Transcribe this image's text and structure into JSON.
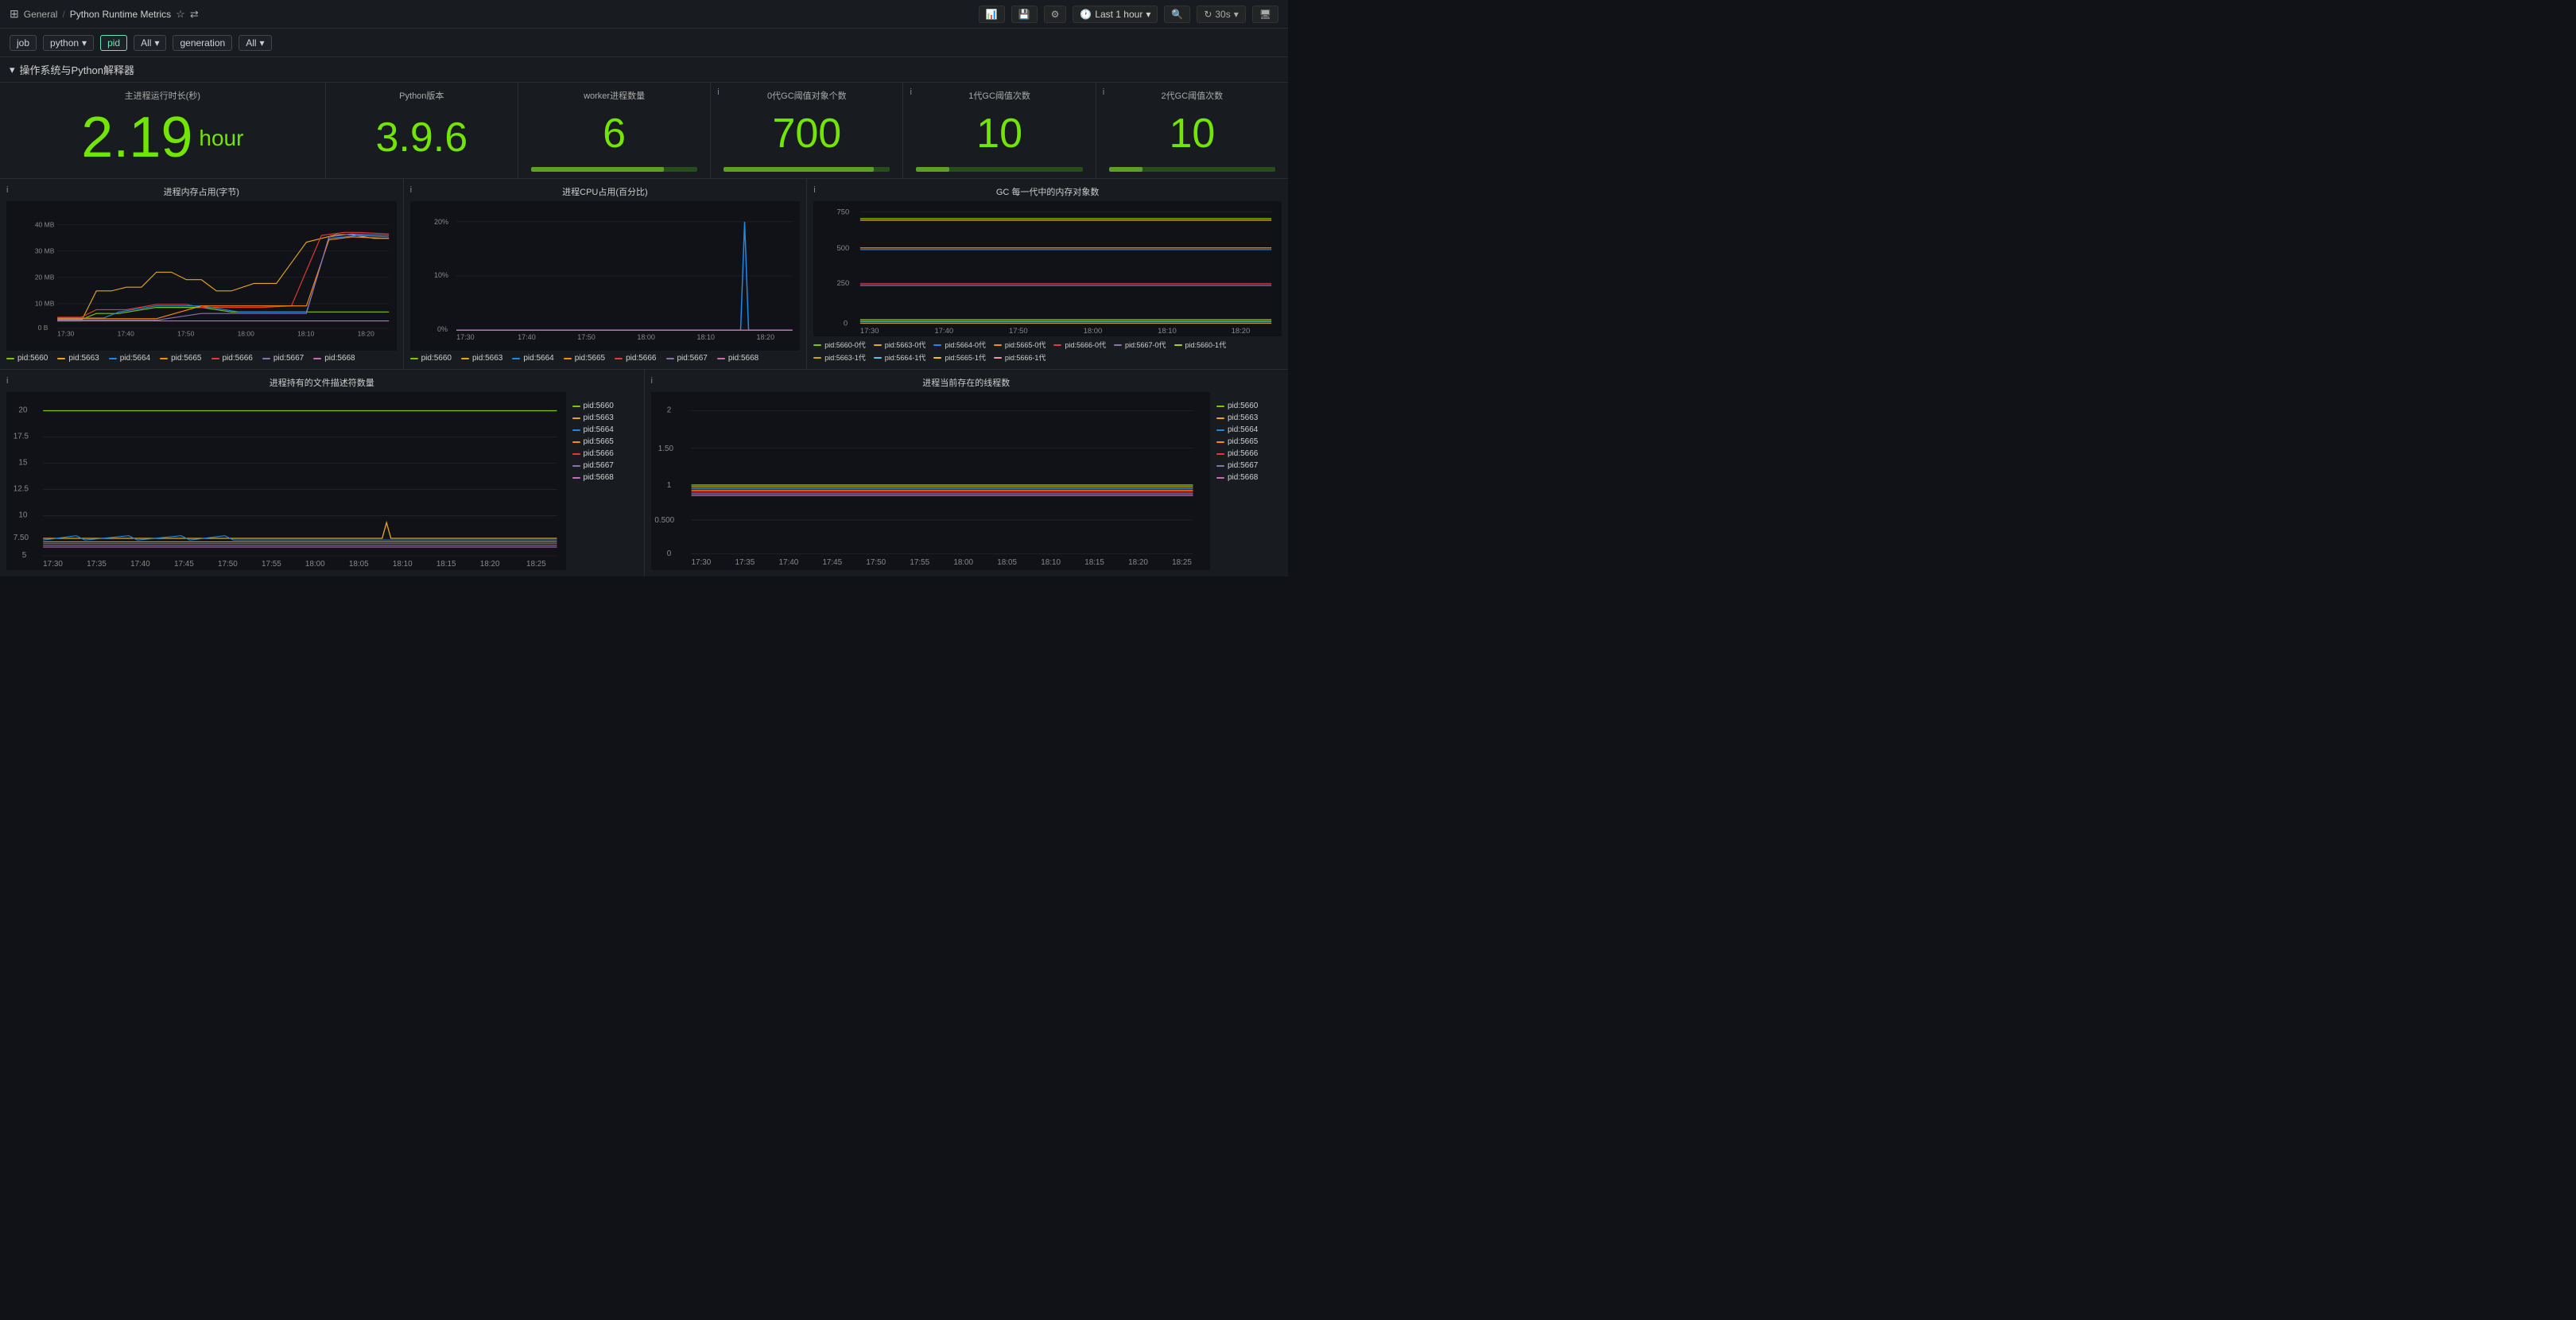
{
  "header": {
    "breadcrumb": "General",
    "separator": "/",
    "title": "Python Runtime Metrics",
    "time_label": "Last 1 hour",
    "refresh_label": "30s",
    "add_panel_icon": "➕",
    "save_icon": "💾",
    "settings_icon": "⚙",
    "zoom_out_icon": "🔍",
    "refresh_icon": "↻",
    "tv_icon": "🖥"
  },
  "filters": [
    {
      "label": "job",
      "value": null,
      "highlight": false
    },
    {
      "label": "python",
      "value": null,
      "highlight": false,
      "has_dropdown": true
    },
    {
      "label": "pid",
      "value": null,
      "highlight": true
    },
    {
      "label": "All",
      "value": null,
      "highlight": false,
      "has_dropdown": true
    },
    {
      "label": "generation",
      "value": null,
      "highlight": false
    },
    {
      "label": "All",
      "value": null,
      "highlight": false,
      "has_dropdown": true
    }
  ],
  "section": {
    "title": "操作系统与Python解释器"
  },
  "stat_cards": [
    {
      "title": "主进程运行时长(秒)",
      "value": "2.19",
      "unit": "hour",
      "large": true,
      "has_bar": false
    },
    {
      "title": "Python版本",
      "value": "3.9.6",
      "unit": "",
      "large": false,
      "has_bar": false
    },
    {
      "title": "worker进程数量",
      "value": "6",
      "unit": "",
      "large": false,
      "has_bar": true,
      "bar_fill": 80
    },
    {
      "title": "0代GC阈值对象个数",
      "value": "700",
      "unit": "",
      "large": false,
      "has_bar": true,
      "bar_fill": 90
    },
    {
      "title": "1代GC阈值次数",
      "value": "10",
      "unit": "",
      "large": false,
      "has_bar": true,
      "bar_fill": 20
    },
    {
      "title": "2代GC阈值次数",
      "value": "10",
      "unit": "",
      "large": false,
      "has_bar": true,
      "bar_fill": 20
    }
  ],
  "charts_row1": [
    {
      "title": "进程内存占用(字节)",
      "width_pct": 32,
      "y_labels": [
        "40 MB",
        "30 MB",
        "20 MB",
        "10 MB",
        "0 B"
      ],
      "x_labels": [
        "17:30",
        "17:40",
        "17:50",
        "18:00",
        "18:10",
        "18:20"
      ],
      "legend": [
        {
          "label": "pid:5660",
          "color": "#7ec800"
        },
        {
          "label": "pid:5663",
          "color": "#e6a817"
        },
        {
          "label": "pid:5664",
          "color": "#1e88e5"
        },
        {
          "label": "pid:5665",
          "color": "#ff8c00"
        },
        {
          "label": "pid:5666",
          "color": "#e53935"
        },
        {
          "label": "pid:5667",
          "color": "#8b6fb5"
        },
        {
          "label": "pid:5668",
          "color": "#c96ab5"
        }
      ]
    },
    {
      "title": "进程CPU占用(百分比)",
      "width_pct": 32,
      "y_labels": [
        "20%",
        "10%",
        "0%"
      ],
      "x_labels": [
        "17:30",
        "17:40",
        "17:50",
        "18:00",
        "18:10",
        "18:20"
      ],
      "legend": [
        {
          "label": "pid:5660",
          "color": "#7ec800"
        },
        {
          "label": "pid:5663",
          "color": "#e6a817"
        },
        {
          "label": "pid:5664",
          "color": "#1e88e5"
        },
        {
          "label": "pid:5665",
          "color": "#ff8c00"
        },
        {
          "label": "pid:5666",
          "color": "#e53935"
        },
        {
          "label": "pid:5667",
          "color": "#8b6fb5"
        },
        {
          "label": "pid:5668",
          "color": "#c96ab5"
        }
      ]
    },
    {
      "title": "GC 每一代中的内存对象数",
      "width_pct": 36,
      "y_labels": [
        "750",
        "500",
        "250",
        "0"
      ],
      "x_labels": [
        "17:30",
        "17:40",
        "17:50",
        "18:00",
        "18:10",
        "18:20"
      ],
      "legend": [
        {
          "label": "pid:5660-0代",
          "color": "#7ec800"
        },
        {
          "label": "pid:5663-0代",
          "color": "#e6a817"
        },
        {
          "label": "pid:5664-0代",
          "color": "#1e88e5"
        },
        {
          "label": "pid:5665-0代",
          "color": "#ff8c00"
        },
        {
          "label": "pid:5666-0代",
          "color": "#e53935"
        },
        {
          "label": "pid:5667-0代",
          "color": "#8b6fb5"
        },
        {
          "label": "pid:5660-1代",
          "color": "#aad400"
        },
        {
          "label": "pid:5663-1代",
          "color": "#d4a800"
        },
        {
          "label": "pid:5664-1代",
          "color": "#4fc3f7"
        },
        {
          "label": "pid:5665-1代",
          "color": "#ffc107"
        },
        {
          "label": "pid:5666-1代",
          "color": "#ef9a9a"
        }
      ]
    }
  ],
  "charts_row2": [
    {
      "title": "进程持有的文件描述符数量",
      "y_labels": [
        "20",
        "17.5",
        "15",
        "12.5",
        "10",
        "7.50",
        "5"
      ],
      "x_labels": [
        "17:30",
        "17:35",
        "17:40",
        "17:45",
        "17:50",
        "17:55",
        "18:00",
        "18:05",
        "18:10",
        "18:15",
        "18:20",
        "18:25"
      ],
      "legend": [
        {
          "label": "pid:5660",
          "color": "#7ec800"
        },
        {
          "label": "pid:5663",
          "color": "#e6a817"
        },
        {
          "label": "pid:5664",
          "color": "#1e88e5"
        },
        {
          "label": "pid:5665",
          "color": "#ff8c00"
        },
        {
          "label": "pid:5666",
          "color": "#e53935"
        },
        {
          "label": "pid:5667",
          "color": "#8b6fb5"
        },
        {
          "label": "pid:5668",
          "color": "#c96ab5"
        }
      ]
    },
    {
      "title": "进程当前存在的线程数",
      "y_labels": [
        "2",
        "1.50",
        "1",
        "0.500",
        "0"
      ],
      "x_labels": [
        "17:30",
        "17:35",
        "17:40",
        "17:45",
        "17:50",
        "17:55",
        "18:00",
        "18:05",
        "18:10",
        "18:15",
        "18:20",
        "18:25"
      ],
      "legend": [
        {
          "label": "pid:5660",
          "color": "#7ec800"
        },
        {
          "label": "pid:5663",
          "color": "#e6a817"
        },
        {
          "label": "pid:5664",
          "color": "#1e88e5"
        },
        {
          "label": "pid:5665",
          "color": "#ff8c00"
        },
        {
          "label": "pid:5666",
          "color": "#e53935"
        },
        {
          "label": "pid:5667",
          "color": "#8b6fb5"
        },
        {
          "label": "pid:5668",
          "color": "#c96ab5"
        }
      ]
    }
  ],
  "colors": {
    "green": "#73e600",
    "background": "#111217",
    "panel": "#181b1f",
    "border": "#2a2d35"
  }
}
